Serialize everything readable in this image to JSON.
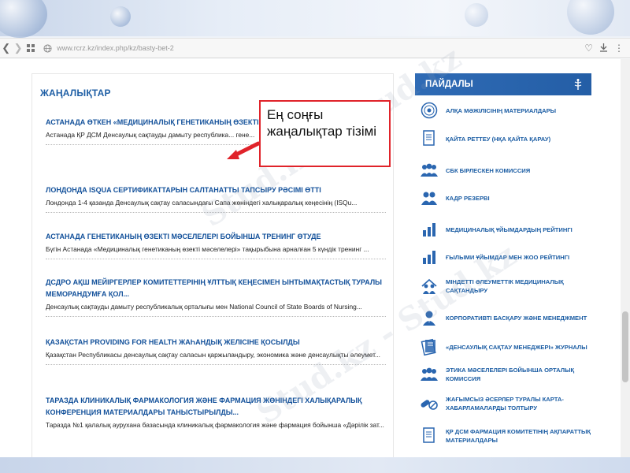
{
  "browser": {
    "url": "www.rcrz.kz/index.php/kz/basty-bet-2",
    "back_icon": "back-arrow-icon",
    "forward_icon": "forward-arrow-icon"
  },
  "news": {
    "section_title": "ЖАҢАЛЫҚТАР",
    "items": [
      {
        "title": "АСТАНАДА ӨТКЕН «МЕДИЦИНАЛЫҚ ГЕНЕТИКАНЫҢ ӨЗЕКТІ М... МӘРЕСІНЕ ЖЕТТІ...",
        "excerpt": "Астанада ҚР ДСМ Денсаулық сақтауды дамыту республика... гене..."
      },
      {
        "title": "ЛОНДОНДА ISQUA СЕРТИФИКАТТАРЫН САЛТАНАТТЫ ТАПСЫРУ РӘСІМІ ӨТТІ",
        "excerpt": "Лондонда 1-4 қазанда Денсаулық сақтау саласындағы Сапа жөніндегі халықаралық кеңесінің (ISQu..."
      },
      {
        "title": "АСТАНАДА ГЕНЕТИКАНЫҢ ӨЗЕКТІ МӘСЕЛЕЛЕРІ БОЙЫНША ТРЕНИНГ ӨТУДЕ",
        "excerpt": "Бүгін Астанада «Медициналық генетиканың өзекті мәселелері» тақырыбына арналған 5 күндік тренинг ..."
      },
      {
        "title": "ДСДРО АҚШ МЕЙІРГЕРЛЕР КОМИТЕТТЕРІНІҢ ҰЛТТЫҚ КЕҢЕСІМЕН ЫНТЫМАҚТАСТЫҚ ТУРАЛЫ МЕМОРАНДУМҒА ҚОЛ...",
        "excerpt": "Денсаулық сақтауды дамыту республикалық орталығы мен National Council of State Boards of Nursing..."
      },
      {
        "title": "ҚАЗАҚСТАН PROVIDING FOR HEALTH ЖАҺАНДЫҚ ЖЕЛІСІНЕ ҚОСЫЛДЫ",
        "excerpt": "Қазақстан Республикасы денсаулық сақтау саласын қаржыландыру, экономика және денсаулықты әлеумет..."
      },
      {
        "title": "ТАРАЗДА КЛИНИКАЛЫҚ ФАРМАКОЛОГИЯ ЖӘНЕ ФАРМАЦИЯ ЖӨНІНДЕГІ ХАЛЫҚАРАЛЫҚ КОНФЕРЕНЦИЯ МАТЕРИАЛДАРЫ ТАНЫСТЫРЫЛДЫ...",
        "excerpt": "Таразда №1 қалалық аурухана базасында клиникалық фармакология және фармация бойынша «Дәрілік зат..."
      }
    ]
  },
  "useful": {
    "header": "ПАЙДАЛЫ",
    "links": [
      {
        "label": "АЛҚА МӘЖІЛІСІНІҢ МАТЕРИАЛДАРЫ",
        "icon": "seal-icon"
      },
      {
        "label": "ҚАЙТА РЕТТЕУ (НҚА ҚАЙТА ҚАРАУ)",
        "icon": "document-icon"
      },
      {
        "label": "СБК БІРЛЕСКЕН КОМИССИЯ",
        "icon": "group-icon"
      },
      {
        "label": "КАДР РЕЗЕРВІ",
        "icon": "people-icon"
      },
      {
        "label": "МЕДИЦИНАЛЫҚ ҰЙЫМДАРДЫҢ РЕЙТИНГІ",
        "icon": "bar-chart-icon"
      },
      {
        "label": "ҒЫЛЫМИ ҰЙЫМДАР МЕН ЖОО РЕЙТИНГІ",
        "icon": "bar-chart-icon"
      },
      {
        "label": "МІНДЕТТІ ӘЛЕУМЕТТІК МЕДИЦИНАЛЫҚ САҚТАНДЫРУ",
        "icon": "family-icon"
      },
      {
        "label": "КОРПОРАТИВТІ БАСҚАРУ ЖӘНЕ МЕНЕДЖМЕНТ",
        "icon": "manager-icon"
      },
      {
        "label": "«ДЕНСАУЛЫҚ САҚТАУ МЕНЕДЖЕРІ» ЖУРНАЛЫ",
        "icon": "journal-icon"
      },
      {
        "label": "ЭТИКА МӘСЕЛЕЛЕРІ БОЙЫНША ОРТАЛЫҚ КОМИССИЯ",
        "icon": "group-icon"
      },
      {
        "label": "ЖАҒЫМСЫЗ ӘСЕРЛЕР ТУРАЛЫ КАРТА-ХАБАРЛАМАЛАРДЫ ТОЛТЫРУ",
        "icon": "pills-icon"
      },
      {
        "label": "ҚР ДСМ ФАРМАЦИЯ КОМИТЕТІНІҢ АҚПАРАТТЫҚ МАТЕРИАЛДАРЫ",
        "icon": "document-icon"
      }
    ]
  },
  "callout": {
    "text": "Ең соңғы жаңалықтар тізімі"
  },
  "watermark": {
    "text": "Stud.kz - Stud.kz"
  }
}
